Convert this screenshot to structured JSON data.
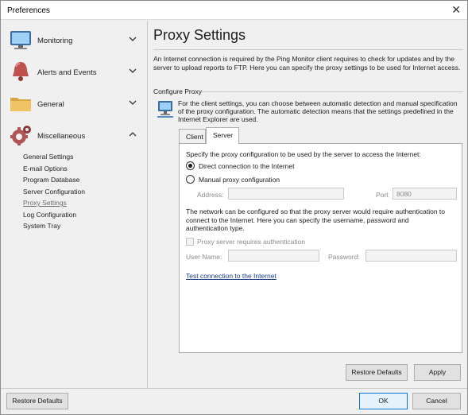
{
  "window": {
    "title": "Preferences"
  },
  "sidebar": {
    "sections": [
      {
        "label": "Monitoring",
        "icon": "monitor-icon",
        "expanded": false
      },
      {
        "label": "Alerts and Events",
        "icon": "bell-icon",
        "expanded": false
      },
      {
        "label": "General",
        "icon": "folder-icon",
        "expanded": false
      },
      {
        "label": "Miscellaneous",
        "icon": "gear-icon",
        "expanded": true
      }
    ],
    "items": [
      {
        "label": "General Settings"
      },
      {
        "label": "E-mail Options"
      },
      {
        "label": "Program Database"
      },
      {
        "label": "Server Configuration"
      },
      {
        "label": "Proxy Settings",
        "active": true
      },
      {
        "label": "Log Configuration"
      },
      {
        "label": "System Tray"
      }
    ]
  },
  "main": {
    "title": "Proxy Settings",
    "intro": "An Internet connection is required by the Ping Monitor client requires to check for updates and by the server to upload reports to FTP. Here you can specify the proxy settings to be used for Internet access.",
    "group_label": "Configure Proxy",
    "group_text": "For the client settings, you can choose between automatic detection and manual specification of the proxy configuration. The automatic detection means that the settings predefined in the Internet Explorer are used.",
    "tabs": [
      {
        "label": "Client"
      },
      {
        "label": "Server",
        "active": true
      }
    ],
    "server": {
      "prompt": "Specify the proxy configuration to be used by the server to access the Internet:",
      "option_direct": "Direct connection to the Internet",
      "option_manual": "Manual proxy configuration",
      "selected": "direct",
      "address_label": "Address:",
      "address_value": "",
      "port_label": "Port",
      "port_value": "8080",
      "auth_text": "The network can be configured so that the proxy server would require authentication to connect to the Internet. Here you can specify the username, password and authentication type.",
      "auth_checkbox": "Proxy server requires authentication",
      "auth_checked": false,
      "username_label": "User Name:",
      "username_value": "",
      "password_label": "Password:",
      "password_value": "",
      "test_link": "Test connection to the Internet"
    },
    "restore_defaults": "Restore Defaults",
    "apply": "Apply"
  },
  "footer": {
    "restore_defaults": "Restore Defaults",
    "ok": "OK",
    "cancel": "Cancel"
  },
  "colors": {
    "accent": "#0078d7",
    "link": "#1a3a8a"
  }
}
